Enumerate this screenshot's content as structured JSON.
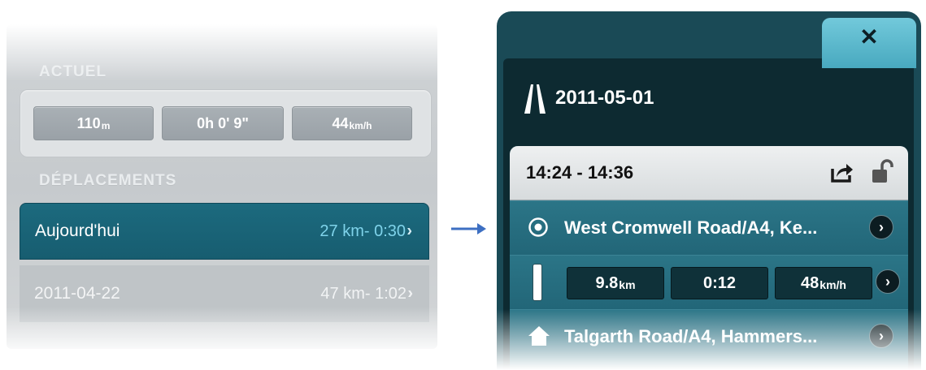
{
  "left": {
    "current_header": "ACTUEL",
    "current_stats": [
      {
        "value": "110",
        "unit": "m"
      },
      {
        "value": "0h 0' 9\"",
        "unit": ""
      },
      {
        "value": "44",
        "unit": "km/h"
      }
    ],
    "trips_header": "DÉPLACEMENTS",
    "trips": [
      {
        "name": "Aujourd'hui",
        "summary": "27 km- 0:30",
        "selected": true
      },
      {
        "name": "2011-04-22",
        "summary": "47 km- 1:02",
        "selected": false
      }
    ]
  },
  "right": {
    "close_label": "✕",
    "date": "2011-05-01",
    "trip_time": "14:24 - 14:36",
    "start_place": "West Cromwell Road/A4, Ke...",
    "segment": [
      {
        "value": "9.8",
        "unit": "km"
      },
      {
        "value": "0:12",
        "unit": ""
      },
      {
        "value": "48",
        "unit": "km/h"
      }
    ],
    "end_place": "Talgarth Road/A4, Hammers..."
  },
  "colors": {
    "accent_teal": "#1c6a7e",
    "accent_light": "#7fd3ea",
    "close_tab": "#5db8cd",
    "panel_dark": "#0d2a31",
    "arrow": "#3d6fc2"
  },
  "icons": [
    "road-icon",
    "share-icon",
    "lock-icon",
    "target-icon",
    "home-icon",
    "chevron-right-icon",
    "close-icon",
    "arrow-right-icon"
  ]
}
